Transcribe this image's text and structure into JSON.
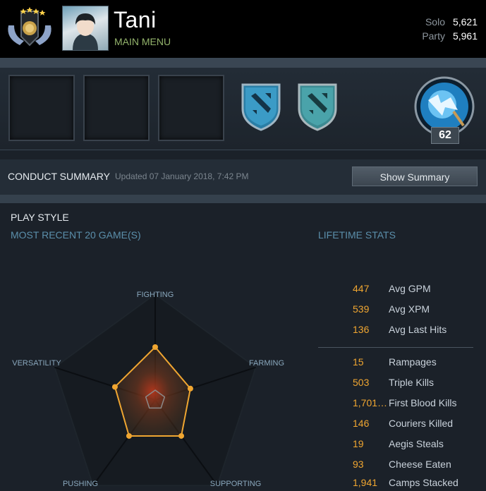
{
  "header": {
    "player_name": "Tani",
    "main_menu": "MAIN MENU",
    "mmr": [
      {
        "label": "Solo",
        "value": "5,621"
      },
      {
        "label": "Party",
        "value": "5,961"
      }
    ]
  },
  "showcase": {
    "hero_level": "62"
  },
  "conduct": {
    "title": "CONDUCT SUMMARY",
    "updated": "Updated 07 January 2018, 7:42 PM",
    "button": "Show Summary"
  },
  "playstyle": {
    "title": "PLAY STYLE",
    "recent": "MOST RECENT 20 GAME(S)",
    "axes": [
      "FIGHTING",
      "FARMING",
      "SUPPORTING",
      "PUSHING",
      "VERSATILITY"
    ],
    "levels": [
      0.5,
      0.35,
      0.42,
      0.42,
      0.4
    ]
  },
  "lifetime": {
    "title": "LIFETIME STATS",
    "group1": [
      {
        "value": "447",
        "label": "Avg GPM"
      },
      {
        "value": "539",
        "label": "Avg XPM"
      },
      {
        "value": "136",
        "label": "Avg Last Hits"
      }
    ],
    "group2": [
      {
        "value": "15",
        "label": "Rampages"
      },
      {
        "value": "503",
        "label": "Triple Kills"
      },
      {
        "value": "1,701,…",
        "label": "First Blood Kills"
      },
      {
        "value": "146",
        "label": "Couriers Killed"
      },
      {
        "value": "19",
        "label": "Aegis Steals"
      },
      {
        "value": "93",
        "label": "Cheese Eaten"
      },
      {
        "value": "1,941",
        "label": "Camps Stacked"
      }
    ]
  },
  "colors": {
    "accent": "#f0a631",
    "section_blue": "#5b8fab",
    "menu_green": "#93b36b"
  }
}
